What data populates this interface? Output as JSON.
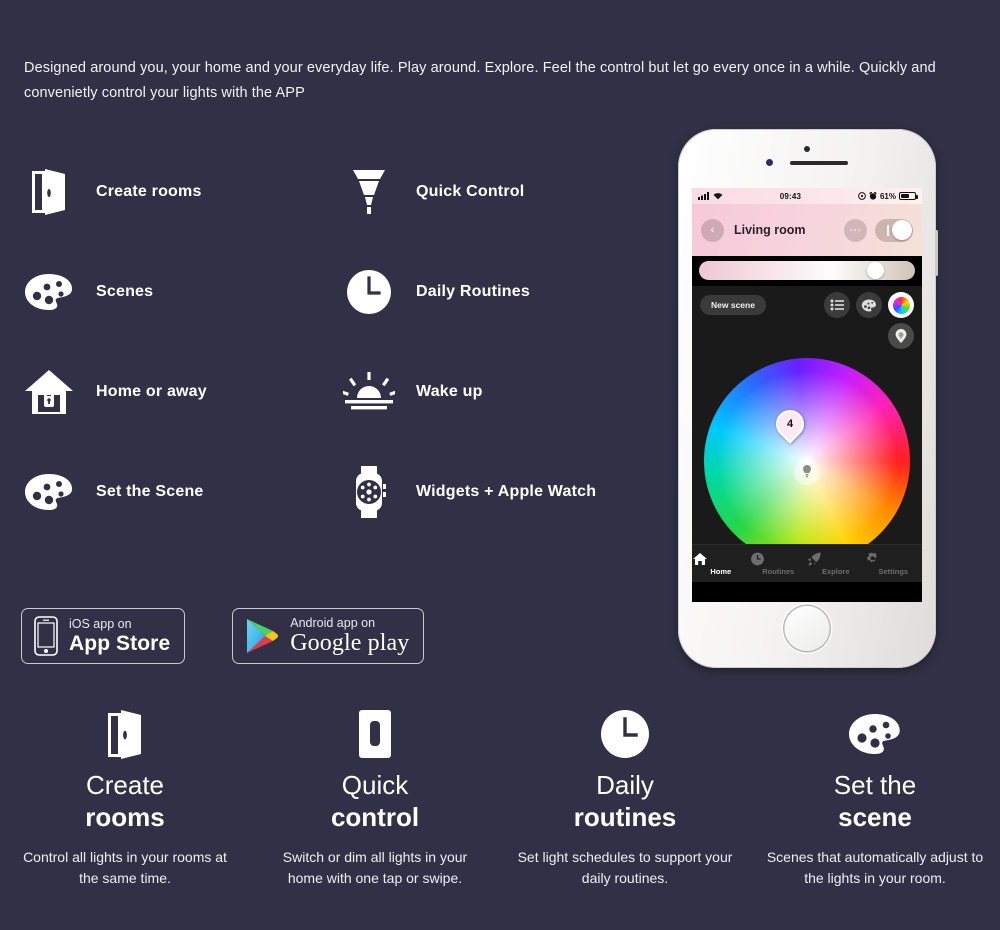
{
  "intro": {
    "text": "Designed around you, your home and your everyday life. Play around. Explore. Feel the control but let go every once in a while. Quickly and convenietly control your lights with the  APP"
  },
  "colors": {
    "background": "#313046",
    "text": "#ffffff",
    "phone_body": "#f3f2f0",
    "screen_bg": "#000000",
    "header_pink": "#f6c9d8",
    "nav_active": "#ffffff",
    "nav_inactive": "#6d6d6d"
  },
  "features": [
    {
      "icon": "open-door-icon",
      "label": "Create rooms"
    },
    {
      "icon": "bulb-icon",
      "label": "Quick Control"
    },
    {
      "icon": "palette-icon",
      "label": "Scenes"
    },
    {
      "icon": "clock-icon",
      "label": "Daily Routines"
    },
    {
      "icon": "house-lock-icon",
      "label": "Home or away"
    },
    {
      "icon": "sunrise-icon",
      "label": "Wake up"
    },
    {
      "icon": "palette-icon",
      "label": "Set the Scene"
    },
    {
      "icon": "apple-watch-icon",
      "label": "Widgets + Apple Watch"
    }
  ],
  "badges": {
    "ios": {
      "icon": "iphone-icon",
      "small": "iOS app on",
      "big": "App Store"
    },
    "android": {
      "icon": "google-play-triangle-icon",
      "small": "Android app on",
      "big_first": "Google",
      "big_second": "play"
    }
  },
  "phone": {
    "status_bar": {
      "time": "09:43",
      "battery": "61%",
      "signal_icon": "cellular-bars-icon",
      "wifi_icon": "wifi-icon",
      "alarm_icon": "alarm-icon",
      "lock_icon": "rotation-lock-icon"
    },
    "header": {
      "back_icon": "chevron-left-icon",
      "room": "Living room",
      "more_icon": "ellipsis-icon",
      "toggle_state": "on"
    },
    "brightness": {
      "value_percent": 78
    },
    "toolbar": {
      "new_scene": "New scene",
      "list_icon": "list-icon",
      "palette_icon": "palette-icon",
      "color-wheel_icon": "color-wheel-icon",
      "bulb_icon": "bulb-drop-icon"
    },
    "color_wheel": {
      "marker_label": "4",
      "center_icon": "bulb-icon"
    },
    "nav": [
      {
        "icon": "home-icon",
        "label": "Home",
        "active": true
      },
      {
        "icon": "clock-icon",
        "label": "Routines",
        "active": false
      },
      {
        "icon": "rocket-icon",
        "label": "Explore",
        "active": false
      },
      {
        "icon": "gear-icon",
        "label": "Settings",
        "active": false
      }
    ]
  },
  "cards": [
    {
      "icon": "open-door-icon",
      "title_top": "Create",
      "title_bottom": "rooms",
      "desc": "Control all lights in your rooms at the same time."
    },
    {
      "icon": "switch-icon",
      "title_top": "Quick",
      "title_bottom": "control",
      "desc": "Switch or dim all lights in your home with one tap or swipe."
    },
    {
      "icon": "clock-icon",
      "title_top": "Daily",
      "title_bottom": "routines",
      "desc": "Set light schedules to support your daily routines."
    },
    {
      "icon": "palette-icon",
      "title_top": "Set the",
      "title_bottom": "scene",
      "desc": "Scenes that automatically adjust to the lights in your room."
    }
  ]
}
